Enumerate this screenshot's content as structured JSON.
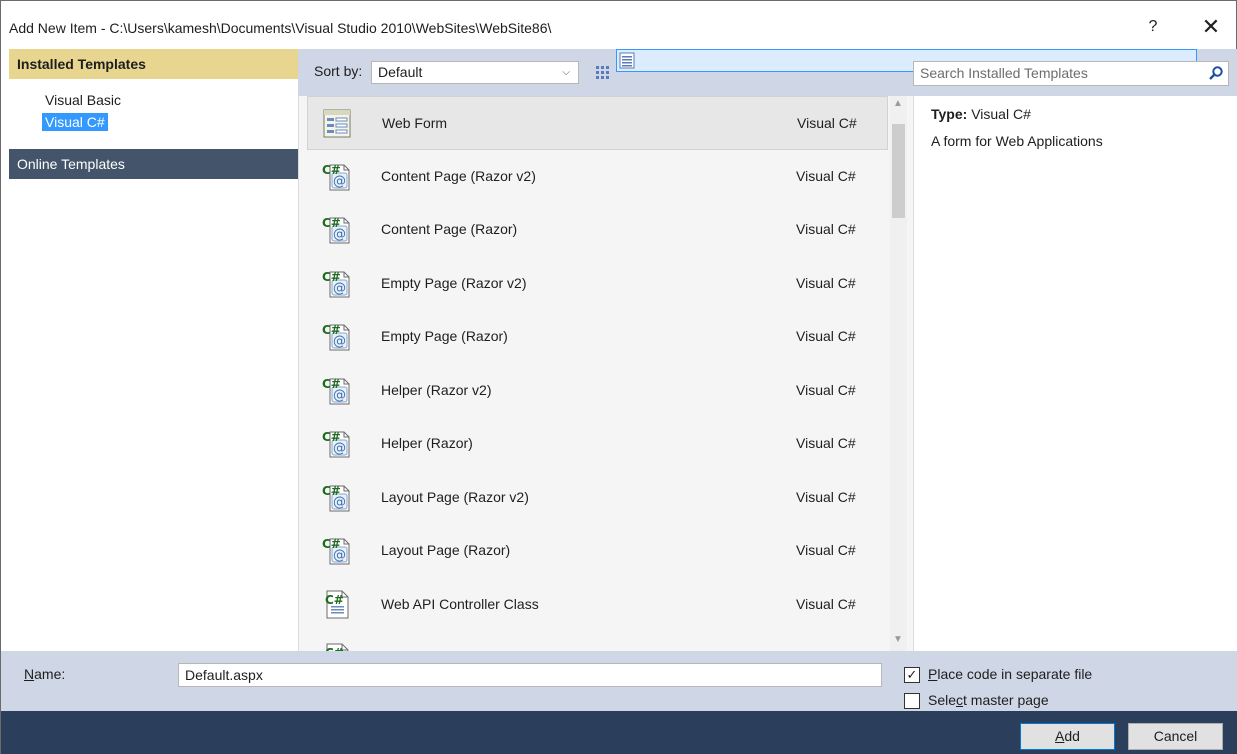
{
  "window": {
    "title": "Add New Item - C:\\Users\\kamesh\\Documents\\Visual Studio 2010\\WebSites\\WebSite86\\",
    "help_label": "?",
    "close_label": "✕"
  },
  "sidebar": {
    "header": "Installed Templates",
    "items": [
      {
        "label": "Visual Basic",
        "selected": false
      },
      {
        "label": "Visual C#",
        "selected": true
      }
    ],
    "online": "Online Templates"
  },
  "toolbar": {
    "sort_label": "Sort by:",
    "sort_value": "Default",
    "search_placeholder": "Search Installed Templates"
  },
  "templates": [
    {
      "name": "Web Form",
      "lang": "Visual C#",
      "icon": "web-form-icon",
      "selected": true
    },
    {
      "name": "Content Page (Razor v2)",
      "lang": "Visual C#",
      "icon": "razor-page-icon"
    },
    {
      "name": "Content Page (Razor)",
      "lang": "Visual C#",
      "icon": "razor-page-icon"
    },
    {
      "name": "Empty Page (Razor v2)",
      "lang": "Visual C#",
      "icon": "razor-page-icon"
    },
    {
      "name": "Empty Page (Razor)",
      "lang": "Visual C#",
      "icon": "razor-page-icon"
    },
    {
      "name": "Helper (Razor v2)",
      "lang": "Visual C#",
      "icon": "razor-page-icon"
    },
    {
      "name": "Helper (Razor)",
      "lang": "Visual C#",
      "icon": "razor-page-icon"
    },
    {
      "name": "Layout Page (Razor v2)",
      "lang": "Visual C#",
      "icon": "razor-page-icon"
    },
    {
      "name": "Layout Page (Razor)",
      "lang": "Visual C#",
      "icon": "razor-page-icon"
    },
    {
      "name": "Web API Controller Class",
      "lang": "Visual C#",
      "icon": "csharp-class-icon"
    }
  ],
  "detail": {
    "type_label": "Type:",
    "type_value": "Visual C#",
    "description": "A form for Web Applications"
  },
  "form": {
    "name_label_pre": "",
    "name_label_u": "N",
    "name_label_post": "ame:",
    "name_value": "Default.aspx",
    "place_code_u": "P",
    "place_code_post": "lace code in separate file",
    "place_code_checked": true,
    "master_pre": "Sele",
    "master_u": "c",
    "master_post": "t master page",
    "master_checked": false
  },
  "buttons": {
    "add_u": "A",
    "add_post": "dd",
    "cancel": "Cancel"
  }
}
